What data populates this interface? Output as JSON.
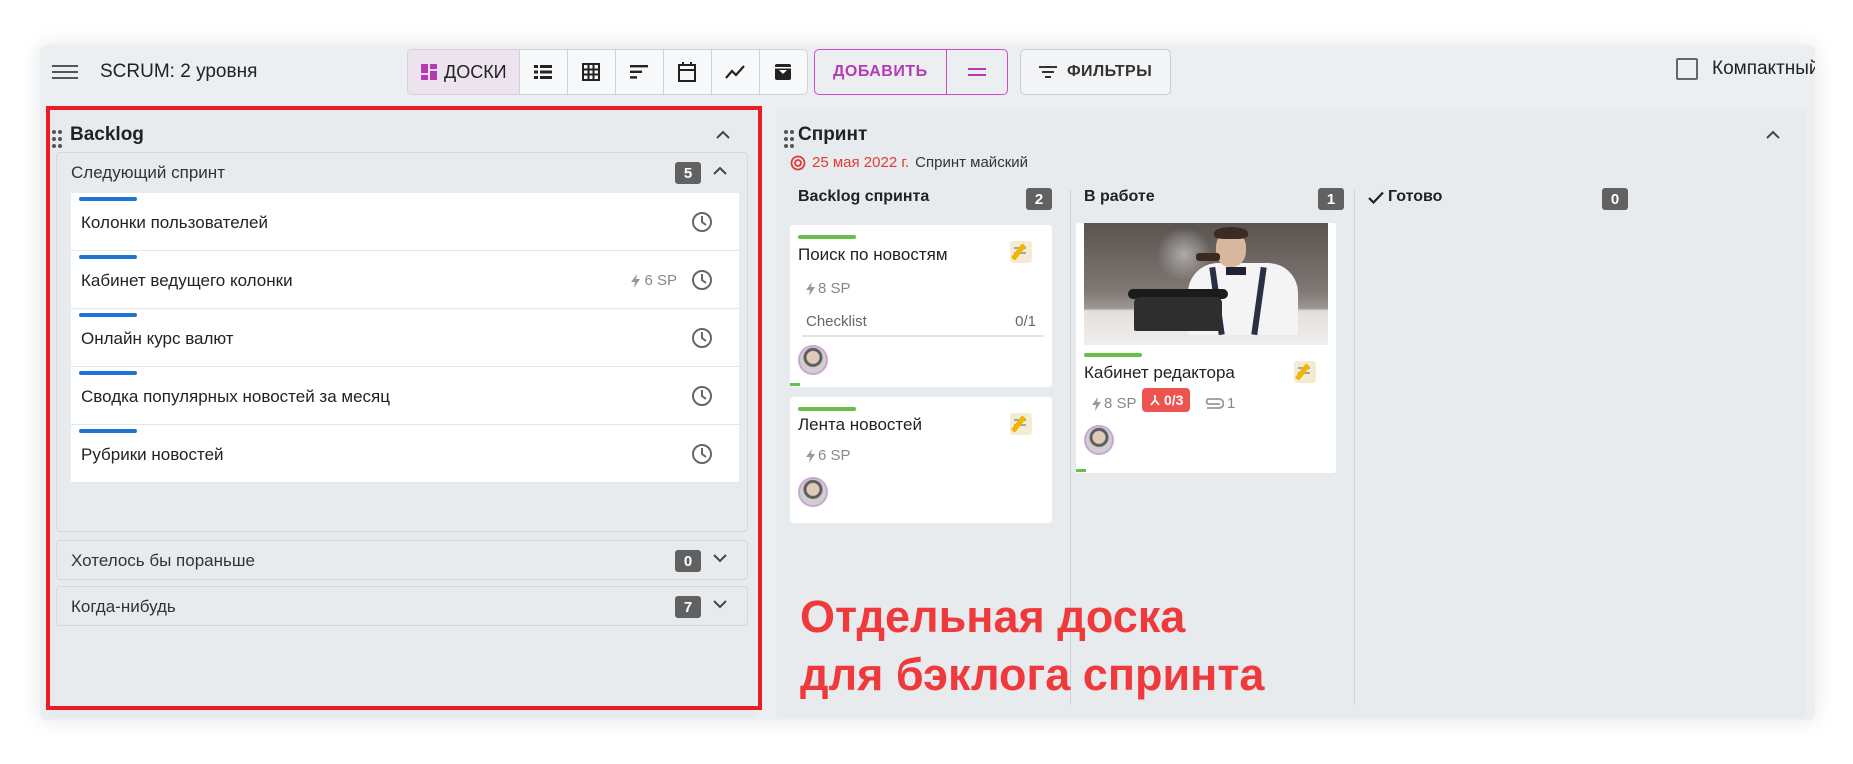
{
  "toolbar": {
    "title": "SCRUM: 2 уровня",
    "views": [
      {
        "icon": "board-icon",
        "label": "ДОСКИ",
        "active": true
      },
      {
        "icon": "list-icon"
      },
      {
        "icon": "table-icon"
      },
      {
        "icon": "sort-icon"
      },
      {
        "icon": "calendar-icon"
      },
      {
        "icon": "chart-icon"
      },
      {
        "icon": "archive-icon"
      }
    ],
    "add_label": "ДОБАВИТЬ",
    "filters_label": "ФИЛЬТРЫ",
    "compact_label": "Компактный"
  },
  "backlog": {
    "title": "Backlog",
    "groups": [
      {
        "title": "Следующий спринт",
        "count": "5",
        "tasks": [
          {
            "name": "Колонки пользователей",
            "sp": ""
          },
          {
            "name": "Кабинет ведущего колонки",
            "sp": "6 SP"
          },
          {
            "name": "Онлайн курс валют",
            "sp": ""
          },
          {
            "name": "Сводка популярных новостей за месяц",
            "sp": ""
          },
          {
            "name": "Рубрики новостей",
            "sp": ""
          }
        ]
      },
      {
        "title": "Хотелось бы пораньше",
        "count": "0"
      },
      {
        "title": "Когда-нибудь",
        "count": "7"
      }
    ]
  },
  "sprint": {
    "title": "Спринт",
    "date": "25 мая 2022 г.",
    "name": "Спринт майский",
    "columns": [
      {
        "title": "Backlog спринта",
        "count": "2",
        "cards": [
          {
            "title": "Поиск по новостям",
            "sp": "8 SP",
            "checklist": "Checklist",
            "checklist_count": "0/1"
          },
          {
            "title": "Лента новостей",
            "sp": "6 SP"
          }
        ]
      },
      {
        "title": "В работе",
        "count": "1",
        "cards": [
          {
            "title": "Кабинет редактора",
            "sp": "8 SP",
            "subtasks": "0/3",
            "attachments": "1"
          }
        ]
      },
      {
        "title": "Готово",
        "count": "0",
        "cards": []
      }
    ]
  },
  "annotation": {
    "line1": "Отдельная доска",
    "line2": "для бэклога спринта"
  },
  "colors": {
    "accent": "#b43bb4",
    "task_bar": "#1e74d6",
    "card_bar": "#66c04a",
    "highlight": "#ec1c24",
    "annotation": "#f0393b"
  }
}
